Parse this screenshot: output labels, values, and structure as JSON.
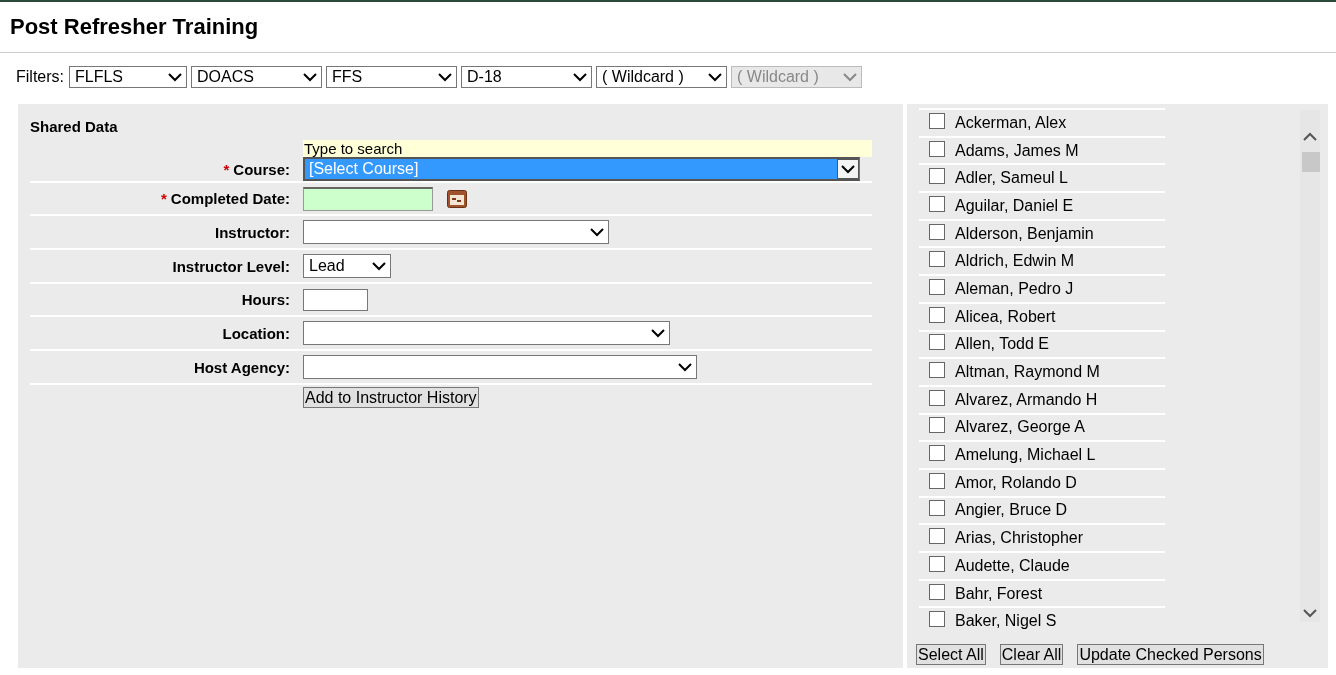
{
  "page_title": "Post Refresher Training",
  "filters": {
    "label": "Filters:",
    "items": [
      {
        "value": "FLFLS",
        "disabled": false
      },
      {
        "value": "DOACS",
        "disabled": false
      },
      {
        "value": "FFS",
        "disabled": false
      },
      {
        "value": "D-18",
        "disabled": false
      },
      {
        "value": "( Wildcard )",
        "disabled": false
      },
      {
        "value": "( Wildcard )",
        "disabled": true
      }
    ]
  },
  "shared_data": {
    "title": "Shared Data",
    "fields": [
      {
        "kind": "combo",
        "label": "Course:",
        "required_marker": "*",
        "hint": "Type to search",
        "value": "[Select Course]"
      },
      {
        "kind": "date",
        "label": "Completed Date:",
        "required_marker": "*"
      },
      {
        "kind": "dropdown",
        "label": "Instructor:"
      },
      {
        "kind": "dropdown",
        "label": "Instructor Level:",
        "value": "Lead"
      },
      {
        "kind": "text",
        "label": "Hours:"
      },
      {
        "kind": "dropdown",
        "label": "Location:"
      },
      {
        "kind": "dropdown",
        "label": "Host Agency:"
      }
    ],
    "submit": "Add to Instructor History"
  },
  "persons": [
    {
      "name": "Ackerman, Alex",
      "checked": false
    },
    {
      "name": "Adams, James M",
      "checked": false
    },
    {
      "name": "Adler, Sameul L",
      "checked": false
    },
    {
      "name": "Aguilar, Daniel E",
      "checked": false
    },
    {
      "name": "Alderson, Benjamin",
      "checked": false
    },
    {
      "name": "Aldrich, Edwin M",
      "checked": false
    },
    {
      "name": "Aleman, Pedro J",
      "checked": false
    },
    {
      "name": "Alicea, Robert",
      "checked": false
    },
    {
      "name": "Allen, Todd E",
      "checked": false
    },
    {
      "name": "Altman, Raymond M",
      "checked": false
    },
    {
      "name": "Alvarez, Armando H",
      "checked": false
    },
    {
      "name": "Alvarez, George A",
      "checked": false
    },
    {
      "name": "Amelung, Michael L",
      "checked": false
    },
    {
      "name": "Amor, Rolando D",
      "checked": false
    },
    {
      "name": "Angier, Bruce D",
      "checked": false
    },
    {
      "name": "Arias, Christopher",
      "checked": false
    },
    {
      "name": "Audette, Claude",
      "checked": false
    },
    {
      "name": "Bahr, Forest",
      "checked": false
    },
    {
      "name": "Baker, Nigel S",
      "checked": false
    }
  ],
  "person_buttons": [
    "Select All",
    "Clear All",
    "Update Checked Persons"
  ]
}
